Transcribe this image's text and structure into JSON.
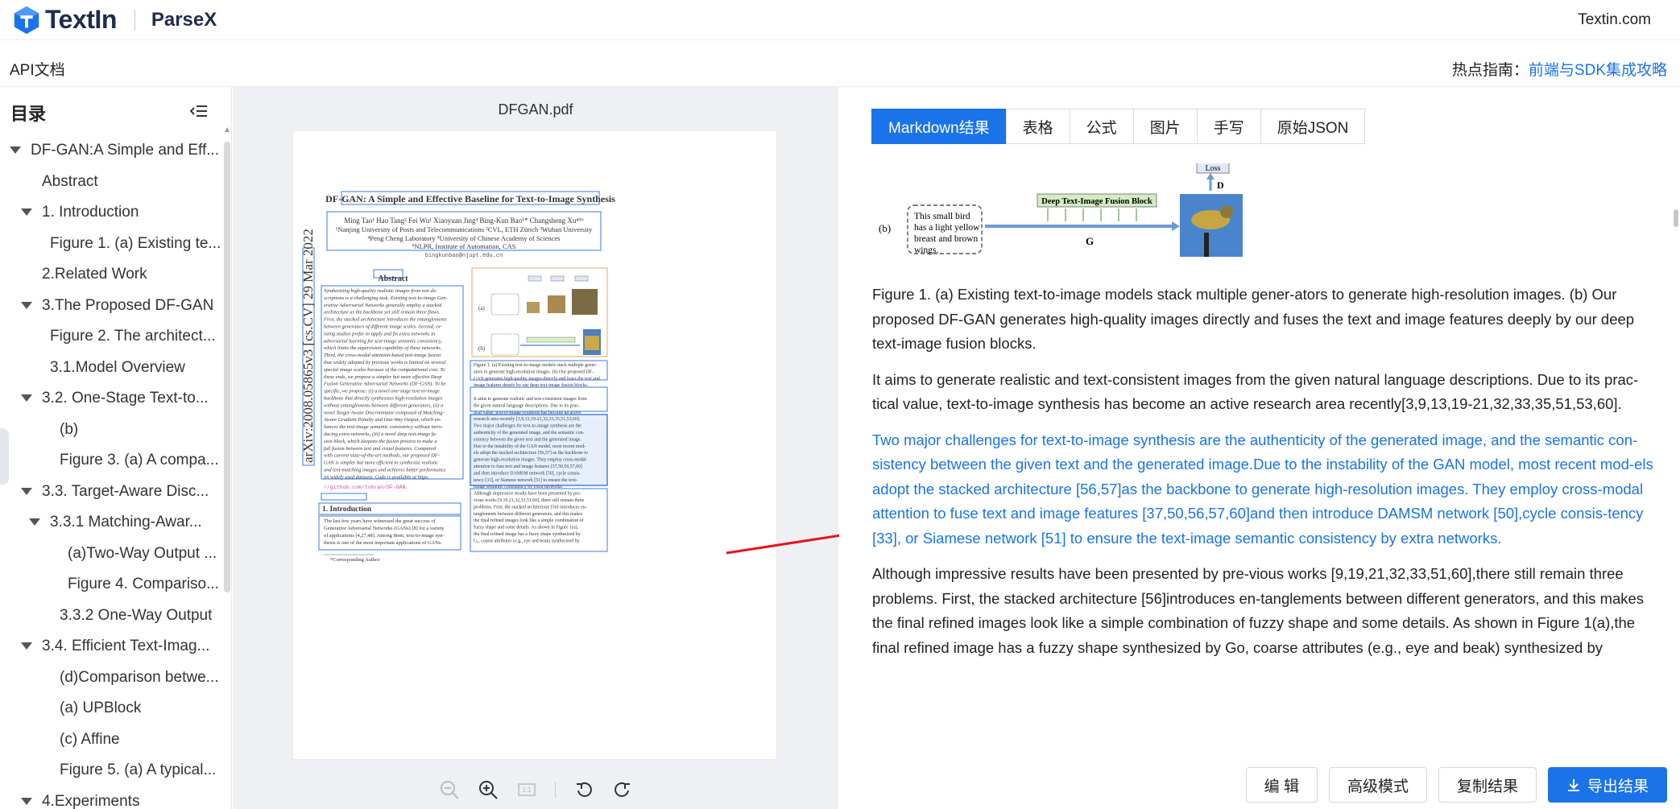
{
  "header": {
    "logo_text": "TextIn",
    "product": "ParseX",
    "site_link": "Textin.com"
  },
  "subbar": {
    "api_doc": "API文档",
    "hot_label": "热点指南：",
    "hot_link": "前端与SDK集成攻略"
  },
  "toc": {
    "title": "目录",
    "items": [
      {
        "label": "DF-GAN:A Simple and Eff...",
        "level": 0,
        "caret": "down"
      },
      {
        "label": "Abstract",
        "level": 1,
        "caret": "none"
      },
      {
        "label": "1. Introduction",
        "level": 1,
        "caret": "down"
      },
      {
        "label": "Figure 1. (a) Existing te...",
        "level": 2,
        "caret": "none"
      },
      {
        "label": "2.Related Work",
        "level": 1,
        "caret": "none"
      },
      {
        "label": "3.The Proposed DF-GAN",
        "level": 1,
        "caret": "down"
      },
      {
        "label": "Figure 2. The architect...",
        "level": 2,
        "caret": "none"
      },
      {
        "label": "3.1.Model Overview",
        "level": 2,
        "caret": "none"
      },
      {
        "label": "3.2. One-Stage Text-to...",
        "level": 2,
        "caret": "down"
      },
      {
        "label": "(b)",
        "level": 3,
        "caret": "none"
      },
      {
        "label": "Figure 3. (a) A compa...",
        "level": 3,
        "caret": "none"
      },
      {
        "label": "3.3. Target-Aware Disc...",
        "level": 2,
        "caret": "down"
      },
      {
        "label": "3.3.1 Matching-Awar...",
        "level": 3,
        "caret": "down"
      },
      {
        "label": "(a)Two-Way Output ...",
        "level": 4,
        "caret": "none"
      },
      {
        "label": "Figure 4. Compariso...",
        "level": 4,
        "caret": "none"
      },
      {
        "label": "3.3.2 One-Way Output",
        "level": 3,
        "caret": "none"
      },
      {
        "label": "3.4. Efficient Text-Imag...",
        "level": 2,
        "caret": "down"
      },
      {
        "label": "(d)Comparison betwe...",
        "level": 3,
        "caret": "none"
      },
      {
        "label": "(a) UPBlock",
        "level": 3,
        "caret": "none"
      },
      {
        "label": "(c) Affine",
        "level": 3,
        "caret": "none"
      },
      {
        "label": "Figure 5. (a) A typical...",
        "level": 3,
        "caret": "none"
      },
      {
        "label": "4.Experiments",
        "level": 1,
        "caret": "down"
      }
    ]
  },
  "viewer": {
    "file_name": "DFGAN.pdf",
    "page": {
      "title": "DF-GAN: A Simple and Effective Baseline for Text-to-Image Synthesis",
      "authors": "Ming Tao¹   Hao Tang²   Fei Wu¹   Xiaoyuan Jing³   Bing-Kun Bao¹*   Changsheng Xu⁴⁵⁶",
      "aff1": "¹Nanjing University of Posts and Telecommunications   ²CVL, ETH Zürich   ³Wuhan University",
      "aff2": "⁴Peng Cheng Laboratory   ⁵University of Chinese Academy of Sciences",
      "aff3": "⁶NLPR, Institute of Automation, CAS",
      "email": "bingkunbao@njupt.edu.cn",
      "side_id": "arXiv:2008.05865v3  [cs.CV]  29 Mar 2022",
      "abstract_head": "Abstract",
      "abstract_lines": [
        "Synthesizing high-quality realistic images from text de-",
        "scriptions is a challenging task. Existing text-to-image Gen-",
        "erative Adversarial Networks generally employ a stacked",
        "architecture as the backbone yet still remain three flaws.",
        "First, the stacked architecture introduces the entanglements",
        "between generators of different image scales. Second, ex-",
        "isting studies prefer to apply and fix extra networks in",
        "adversarial learning for text-image semantic consistency,",
        "which limits the supervision capability of these networks.",
        "Third, the cross-modal attention-based text-image fusion",
        "that widely adopted by previous works is limited on several",
        "special image scales because of the computational cost. To",
        "these ends, we propose a simpler but more effective Deep",
        "Fusion Generative Adversarial Networks (DF-GAN). To be",
        "specific, we propose: (i) a novel one-stage text-to-image",
        "backbone that directly synthesizes high-resolution images",
        "without entanglements between different generators, (ii) a",
        "novel Target-Aware Discriminator composed of Matching-",
        "Aware Gradient Penalty and One-Way Output, which en-",
        "hances the text-image semantic consistency without intro-",
        "ducing extra networks, (iii) a novel deep text-image fu-",
        "sion block, which deepens the fusion process to make a",
        "full fusion between text and visual features. Compared",
        "with current state-of-the-art methods, our proposed DF-",
        "GAN is simpler but more efficient to synthesize realistic",
        "and text-matching images and achieves better performance",
        "on widely used datasets. Code is available at https:"
      ],
      "abstract_link": "//github.com/tobran/DF-GAN.",
      "intro_head": "1. Introduction",
      "intro_lines": [
        "The last few years have witnessed the great success of",
        "Generative Adversarial Networks (GANs) [8] for a variety",
        "of applications [4,27,48]. Among them, text-to-image syn-",
        "thesis is one of the most important applications of GANs."
      ],
      "footnote": "*Corresponding Author",
      "right_lines": [
        "Figure 1. (a) Existing text-to-image models stack multiple gener-",
        "ators to generate high-resolution images. (b) Our proposed DF-",
        "GAN generates high-quality images directly and fuses the text and",
        "image features deeply by our deep text-image fusion blocks.",
        "",
        "It aims to generate realistic and text-consistent images from",
        "the given natural language descriptions. Due to its prac-",
        "tical value, text-to-image synthesis has become an active",
        "research area recently [3,9,13,19-21,32,33,35,51,53,60].",
        "Two major challenges for text-to-image synthesis are the",
        "authenticity of the generated image, and the semantic con-",
        "sistency between the given text and the generated image.",
        "Due to the instability of the GAN model, most recent mod-",
        "els adopt the stacked architecture [56,57] as the backbone to",
        "generate high-resolution images. They employ cross-modal",
        "attention to fuse text and image features [37,50,56,57,60]",
        "and then introduce DAMSM network [50], cycle consis-",
        "tency [33], or Siamese network [51] to ensure the text-",
        "image semantic consistency by extra networks.",
        "Although impressive results have been presented by pre-",
        "vious works [9,19,21,32,33,51,60], there still remain three",
        "problems. First, the stacked architecture [56] introduces en-",
        "tanglements between different generators, and this makes",
        "the final refined images look like a simple combination of",
        "fuzzy shape and some details. As shown in Figure 1(a),",
        "the final refined image has a fuzzy shape synthesized by",
        "G₀, coarse attributes (e.g., eye and beak) synthesized by"
      ],
      "fig_labels": {
        "a": "(a)",
        "b": "(b)",
        "loss": "Loss",
        "fusion": "Deep Text-Image Fusion Block",
        "bird_text": "This small bird has a light yellow breast and brown wings."
      }
    }
  },
  "result": {
    "tabs": [
      "Markdown结果",
      "表格",
      "公式",
      "图片",
      "手写",
      "原始JSON"
    ],
    "active_tab": 0,
    "figure": {
      "label_b": "(b)",
      "bird_text": [
        "This small bird",
        "has a light yellow",
        "breast and brown",
        "wings."
      ],
      "fusion_block": "Deep Text-Image Fusion Block",
      "g_label": "G",
      "d_label": "D",
      "loss_label": "Loss"
    },
    "paragraphs": [
      "Figure 1. (a) Existing text-to-image models stack multiple gener-ators to generate high-resolution images. (b) Our proposed DF-GAN generates high-quality images directly and fuses the text and image features deeply by our deep text-image fusion blocks.",
      "It aims to generate realistic and text-consistent images from the given natural language descriptions. Due to its prac-tical value, text-to-image synthesis has become an active research area recently[3,9,13,19-21,32,33,35,51,53,60].",
      "Two major challenges for text-to-image synthesis are the authenticity of the generated image, and the semantic con-sistency between the given text and the generated image.Due to the instability of the GAN model, most recent mod-els adopt the stacked architecture [56,57]as the backbone to generate high-resolution images. They employ cross-modal attention to fuse text and image features [37,50,56,57,60]and then introduce DAMSM network [50],cycle consis-tency [33], or Siamese network [51] to ensure the text-image semantic consistency by extra networks.",
      "Although impressive results have been presented by pre-vious works [9,19,21,32,33,51,60],there still remain three problems. First, the stacked architecture [56]introduces en-tanglements between different generators, and this makes the final refined images look like a simple combination of fuzzy shape and some details. As shown in Figure 1(a),the final refined image has a fuzzy shape synthesized by Go, coarse attributes (e.g., eye and beak) synthesized by"
    ],
    "buttons": {
      "edit": "编 辑",
      "advanced": "高级模式",
      "copy": "复制结果",
      "export": "导出结果"
    }
  },
  "colors": {
    "accent": "#1a73e8",
    "arrow": "#e8141c",
    "box_blue": "#3a78e0"
  }
}
